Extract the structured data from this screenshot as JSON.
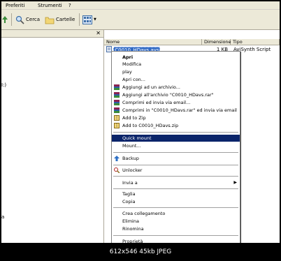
{
  "menubar": {
    "items": [
      "Preferiti",
      "Strumenti",
      "?"
    ]
  },
  "toolbar": {
    "search_label": "Cerca",
    "folders_label": "Cartelle"
  },
  "left_pane": {
    "fragments": [
      "I:)",
      "a"
    ]
  },
  "columns": {
    "name": "Nome",
    "size": "Dimensione",
    "type": "Tipo"
  },
  "file": {
    "name": "C0010_HDavs.avs",
    "size": "1 KB",
    "type": "AviSynth Script"
  },
  "context_menu": {
    "items": [
      {
        "label": "Apri",
        "bold": true,
        "icon": ""
      },
      {
        "label": "Modifica",
        "icon": ""
      },
      {
        "label": "play",
        "icon": ""
      },
      {
        "label": "Apri con...",
        "icon": ""
      },
      {
        "label": "Aggiungi ad un archivio...",
        "icon": "winrar-icon"
      },
      {
        "label": "Aggiungi all'archivio \"C0010_HDavs.rar\"",
        "icon": "winrar-icon"
      },
      {
        "label": "Comprimi ed invia via email...",
        "icon": "winrar-icon"
      },
      {
        "label": "Comprimi in \"C0010_HDavs.rar\" ed invia via email",
        "icon": "winrar-icon"
      },
      {
        "label": "Add to Zip",
        "icon": "zip-icon"
      },
      {
        "label": "Add to C0010_HDavs.zip",
        "icon": "zip-icon"
      },
      {
        "label": "Quick mount",
        "selected": true,
        "icon": ""
      },
      {
        "label": "Mount...",
        "icon": ""
      },
      {
        "label": "Backup",
        "icon": "backup-icon"
      },
      {
        "label": "Unlocker",
        "icon": "unlocker-icon"
      },
      {
        "label": "Invia a",
        "submenu": true,
        "icon": ""
      },
      {
        "label": "Taglia",
        "icon": ""
      },
      {
        "label": "Copia",
        "icon": ""
      },
      {
        "label": "Crea collegamento",
        "icon": ""
      },
      {
        "label": "Elimina",
        "icon": ""
      },
      {
        "label": "Rinomina",
        "icon": ""
      },
      {
        "label": "Proprietà",
        "icon": ""
      }
    ]
  },
  "footer": {
    "caption": "612x546 45kb JPEG"
  }
}
